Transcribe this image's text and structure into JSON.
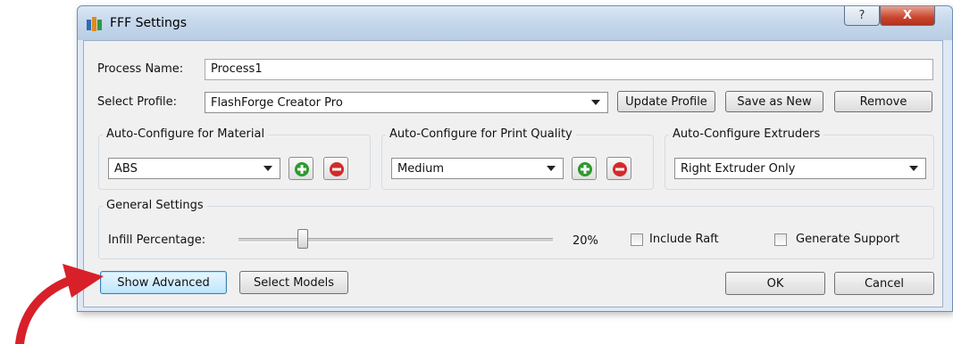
{
  "window": {
    "title": "FFF Settings",
    "help_label": "?",
    "close_label": "X"
  },
  "process": {
    "name_label": "Process Name:",
    "name_value": "Process1"
  },
  "profile": {
    "label": "Select Profile:",
    "selected": "FlashForge Creator Pro",
    "update_button": "Update Profile",
    "save_new_button": "Save as New",
    "remove_button": "Remove"
  },
  "material": {
    "group_title": "Auto-Configure for Material",
    "selected": "ABS"
  },
  "quality": {
    "group_title": "Auto-Configure for Print Quality",
    "selected": "Medium"
  },
  "extruders": {
    "group_title": "Auto-Configure Extruders",
    "selected": "Right Extruder Only"
  },
  "general": {
    "group_title": "General Settings",
    "infill_label": "Infill Percentage:",
    "infill_value": "20%",
    "infill_fraction": 0.2,
    "include_raft_label": "Include Raft",
    "include_raft_checked": false,
    "generate_support_label": "Generate Support",
    "generate_support_checked": false
  },
  "footer": {
    "show_advanced_button": "Show Advanced",
    "select_models_button": "Select Models",
    "ok_button": "OK",
    "cancel_button": "Cancel"
  },
  "colors": {
    "annotation_arrow": "#d8202a",
    "add_icon": "#2e9a2e",
    "remove_icon": "#d42a2a"
  }
}
